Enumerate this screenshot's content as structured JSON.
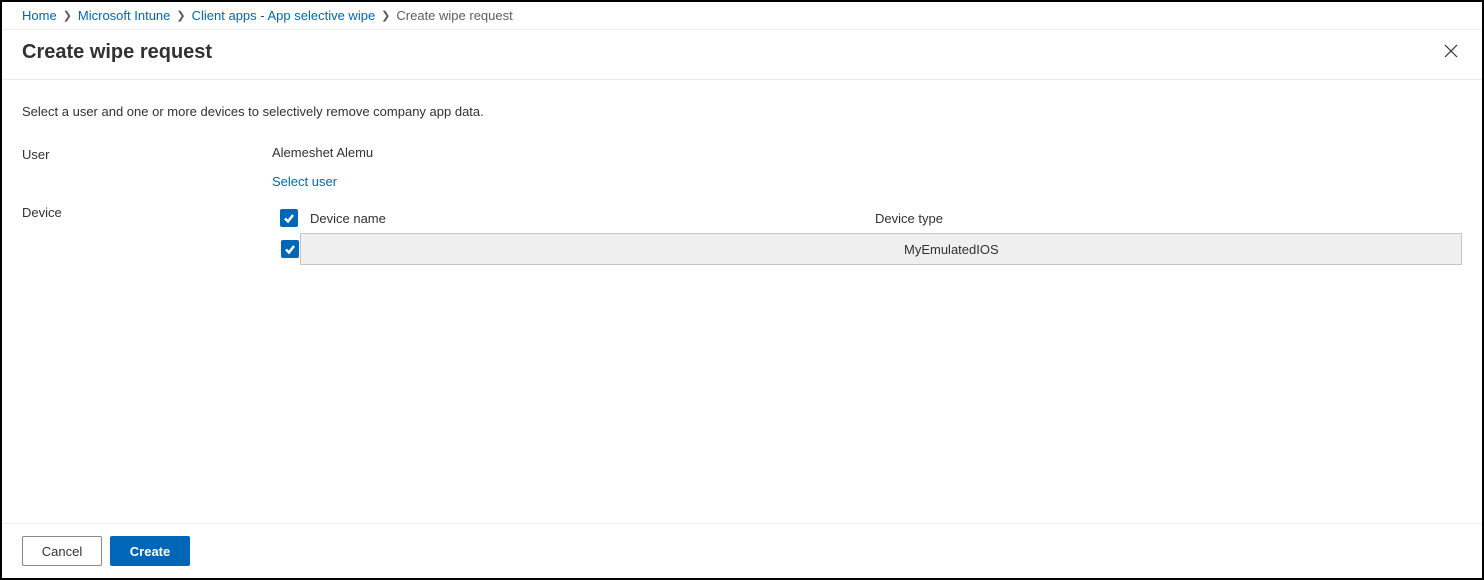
{
  "breadcrumb": {
    "items": [
      {
        "label": "Home",
        "link": true
      },
      {
        "label": "Microsoft Intune",
        "link": true
      },
      {
        "label": "Client apps - App selective wipe",
        "link": true
      },
      {
        "label": "Create wipe request",
        "link": false
      }
    ]
  },
  "header": {
    "title": "Create wipe request"
  },
  "content": {
    "intro": "Select a user and one or more devices to selectively remove company app data.",
    "user_label": "User",
    "user_name": "Alemeshet Alemu",
    "select_user_label": "Select user",
    "device_label": "Device",
    "device_table": {
      "columns": {
        "name": "Device name",
        "type": "Device type"
      },
      "rows": [
        {
          "name": "",
          "type": "MyEmulatedIOS",
          "checked": true
        }
      ],
      "select_all_checked": true
    }
  },
  "footer": {
    "cancel": "Cancel",
    "create": "Create"
  }
}
